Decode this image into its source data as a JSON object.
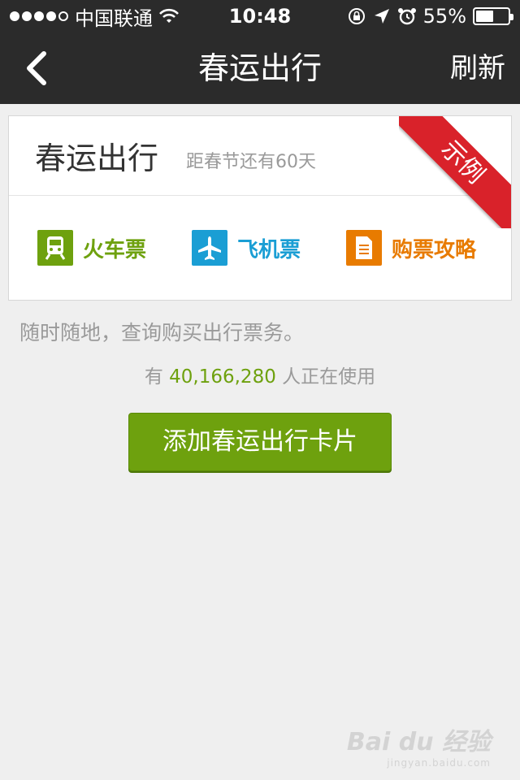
{
  "status_bar": {
    "carrier": "中国联通",
    "time": "10:48",
    "battery_percent": "55%",
    "battery_level": 0.55
  },
  "nav": {
    "title": "春运出行",
    "refresh_label": "刷新",
    "back_icon": "chevron-left-icon"
  },
  "card": {
    "title": "春运出行",
    "subtitle": "距春节还有60天",
    "ribbon": "示例",
    "actions": [
      {
        "label": "火车票",
        "icon": "train-icon",
        "color": "#6ea10e"
      },
      {
        "label": "飞机票",
        "icon": "airplane-icon",
        "color": "#1a9ed4"
      },
      {
        "label": "购票攻略",
        "icon": "document-icon",
        "color": "#e87b00"
      }
    ]
  },
  "description": "随时随地，查询购买出行票务。",
  "usage": {
    "prefix": "有",
    "count": "40,166,280",
    "suffix": "人正在使用"
  },
  "add_button_label": "添加春运出行卡片",
  "watermark": {
    "main": "Bai du 经验",
    "sub": "jingyan.baidu.com"
  }
}
